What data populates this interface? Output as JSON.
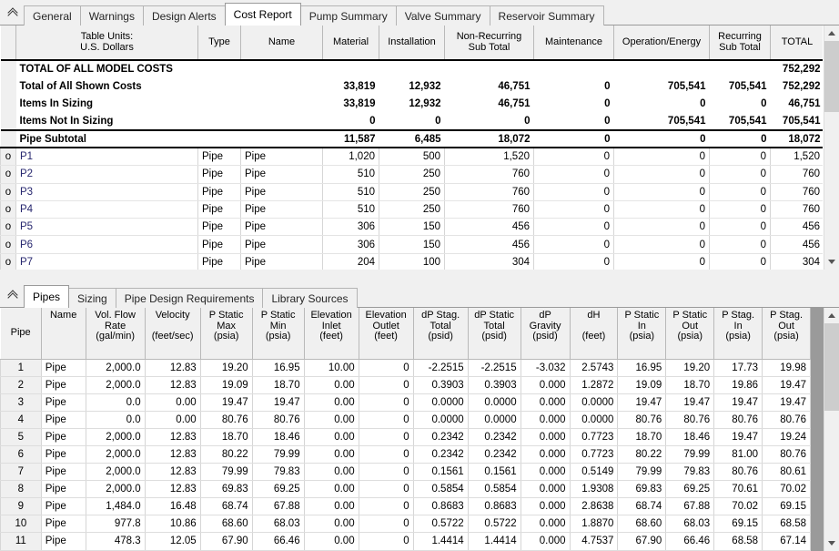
{
  "window": {
    "collapse_icon": "double-chevron-up-icon"
  },
  "top_tabs": {
    "items": [
      {
        "label": "General",
        "active": false
      },
      {
        "label": "Warnings",
        "active": false
      },
      {
        "label": "Design Alerts",
        "active": false
      },
      {
        "label": "Cost Report",
        "active": true
      },
      {
        "label": "Pump Summary",
        "active": false
      },
      {
        "label": "Valve Summary",
        "active": false
      },
      {
        "label": "Reservoir Summary",
        "active": false
      }
    ]
  },
  "cost_report": {
    "columns": [
      {
        "key": "marker",
        "label": ""
      },
      {
        "key": "name",
        "label": "Table Units:\nU.S. Dollars"
      },
      {
        "key": "type",
        "label": "Type"
      },
      {
        "key": "item_name",
        "label": "Name"
      },
      {
        "key": "material",
        "label": "Material"
      },
      {
        "key": "installation",
        "label": "Installation"
      },
      {
        "key": "nonrecurring",
        "label": "Non-Recurring\nSub Total"
      },
      {
        "key": "maintenance",
        "label": "Maintenance"
      },
      {
        "key": "operation",
        "label": "Operation/Energy"
      },
      {
        "key": "recurring",
        "label": "Recurring\nSub Total"
      },
      {
        "key": "total",
        "label": "TOTAL"
      }
    ],
    "column_labels": {
      "units_line1": "Table Units:",
      "units_line2": "U.S. Dollars",
      "type": "Type",
      "name": "Name",
      "material": "Material",
      "installation": "Installation",
      "nonrecurring_line1": "Non-Recurring",
      "nonrecurring_line2": "Sub Total",
      "maintenance": "Maintenance",
      "operation": "Operation/Energy",
      "recurring_line1": "Recurring",
      "recurring_line2": "Sub Total",
      "total": "TOTAL"
    },
    "summary_rows": [
      {
        "label": "TOTAL OF ALL MODEL COSTS",
        "material": "",
        "installation": "",
        "nonrecurring": "",
        "maintenance": "",
        "operation": "",
        "recurring": "",
        "total": "752,292"
      },
      {
        "label": "Total of All Shown Costs",
        "material": "33,819",
        "installation": "12,932",
        "nonrecurring": "46,751",
        "maintenance": "0",
        "operation": "705,541",
        "recurring": "705,541",
        "total": "752,292"
      },
      {
        "label": "Items In Sizing",
        "material": "33,819",
        "installation": "12,932",
        "nonrecurring": "46,751",
        "maintenance": "0",
        "operation": "0",
        "recurring": "0",
        "total": "46,751"
      },
      {
        "label": "Items Not In Sizing",
        "material": "0",
        "installation": "0",
        "nonrecurring": "0",
        "maintenance": "0",
        "operation": "705,541",
        "recurring": "705,541",
        "total": "705,541"
      },
      {
        "label": "Pipe Subtotal",
        "material": "11,587",
        "installation": "6,485",
        "nonrecurring": "18,072",
        "maintenance": "0",
        "operation": "0",
        "recurring": "0",
        "total": "18,072"
      }
    ],
    "item_rows": [
      {
        "marker": "o",
        "label": "P1",
        "type": "Pipe",
        "item_name": "Pipe",
        "material": "1,020",
        "installation": "500",
        "nonrecurring": "1,520",
        "maintenance": "0",
        "operation": "0",
        "recurring": "0",
        "total": "1,520"
      },
      {
        "marker": "o",
        "label": "P2",
        "type": "Pipe",
        "item_name": "Pipe",
        "material": "510",
        "installation": "250",
        "nonrecurring": "760",
        "maintenance": "0",
        "operation": "0",
        "recurring": "0",
        "total": "760"
      },
      {
        "marker": "o",
        "label": "P3",
        "type": "Pipe",
        "item_name": "Pipe",
        "material": "510",
        "installation": "250",
        "nonrecurring": "760",
        "maintenance": "0",
        "operation": "0",
        "recurring": "0",
        "total": "760"
      },
      {
        "marker": "o",
        "label": "P4",
        "type": "Pipe",
        "item_name": "Pipe",
        "material": "510",
        "installation": "250",
        "nonrecurring": "760",
        "maintenance": "0",
        "operation": "0",
        "recurring": "0",
        "total": "760"
      },
      {
        "marker": "o",
        "label": "P5",
        "type": "Pipe",
        "item_name": "Pipe",
        "material": "306",
        "installation": "150",
        "nonrecurring": "456",
        "maintenance": "0",
        "operation": "0",
        "recurring": "0",
        "total": "456"
      },
      {
        "marker": "o",
        "label": "P6",
        "type": "Pipe",
        "item_name": "Pipe",
        "material": "306",
        "installation": "150",
        "nonrecurring": "456",
        "maintenance": "0",
        "operation": "0",
        "recurring": "0",
        "total": "456"
      },
      {
        "marker": "o",
        "label": "P7",
        "type": "Pipe",
        "item_name": "Pipe",
        "material": "204",
        "installation": "100",
        "nonrecurring": "304",
        "maintenance": "0",
        "operation": "0",
        "recurring": "0",
        "total": "304"
      }
    ]
  },
  "bottom_tabs": {
    "items": [
      {
        "label": "Pipes",
        "active": true
      },
      {
        "label": "Sizing",
        "active": false
      },
      {
        "label": "Pipe Design Requirements",
        "active": false
      },
      {
        "label": "Library Sources",
        "active": false
      }
    ]
  },
  "pipes_table": {
    "column_labels": {
      "pipe": "Pipe",
      "name": "Name",
      "volflow_l1": "Vol. Flow",
      "volflow_l2": "Rate",
      "volflow_l3": "(gal/min)",
      "velocity_l1": "Velocity",
      "velocity_l2": "(feet/sec)",
      "pstaticmax_l1": "P Static",
      "pstaticmax_l2": "Max",
      "pstaticmax_l3": "(psia)",
      "pstaticmin_l1": "P Static",
      "pstaticmin_l2": "Min",
      "pstaticmin_l3": "(psia)",
      "elevin_l1": "Elevation",
      "elevin_l2": "Inlet",
      "elevin_l3": "(feet)",
      "elevout_l1": "Elevation",
      "elevout_l2": "Outlet",
      "elevout_l3": "(feet)",
      "dpstag_l1": "dP Stag.",
      "dpstag_l2": "Total",
      "dpstag_l3": "(psid)",
      "dpstatic_l1": "dP Static",
      "dpstatic_l2": "Total",
      "dpstatic_l3": "(psid)",
      "dpgrav_l1": "dP",
      "dpgrav_l2": "Gravity",
      "dpgrav_l3": "(psid)",
      "dh_l1": "dH",
      "dh_l2": "(feet)",
      "pstatin_l1": "P Static",
      "pstatin_l2": "In",
      "pstatin_l3": "(psia)",
      "pstatout_l1": "P Static",
      "pstatout_l2": "Out",
      "pstatout_l3": "(psia)",
      "pstagin_l1": "P Stag.",
      "pstagin_l2": "In",
      "pstagin_l3": "(psia)",
      "pstagout_l1": "P Stag.",
      "pstagout_l2": "Out",
      "pstagout_l3": "(psia)"
    },
    "rows": [
      {
        "num": "1",
        "name": "Pipe",
        "volflow": "2,000.0",
        "velocity": "12.83",
        "pstatic_max": "19.20",
        "pstatic_min": "16.95",
        "elev_in": "10.00",
        "elev_out": "0",
        "dp_stag_total": "-2.2515",
        "dp_static_total": "-2.2515",
        "dp_gravity": "-3.032",
        "dh": "2.5743",
        "pstat_in": "16.95",
        "pstat_out": "19.20",
        "pstag_in": "17.73",
        "pstag_out": "19.98"
      },
      {
        "num": "2",
        "name": "Pipe",
        "volflow": "2,000.0",
        "velocity": "12.83",
        "pstatic_max": "19.09",
        "pstatic_min": "18.70",
        "elev_in": "0.00",
        "elev_out": "0",
        "dp_stag_total": "0.3903",
        "dp_static_total": "0.3903",
        "dp_gravity": "0.000",
        "dh": "1.2872",
        "pstat_in": "19.09",
        "pstat_out": "18.70",
        "pstag_in": "19.86",
        "pstag_out": "19.47"
      },
      {
        "num": "3",
        "name": "Pipe",
        "volflow": "0.0",
        "velocity": "0.00",
        "pstatic_max": "19.47",
        "pstatic_min": "19.47",
        "elev_in": "0.00",
        "elev_out": "0",
        "dp_stag_total": "0.0000",
        "dp_static_total": "0.0000",
        "dp_gravity": "0.000",
        "dh": "0.0000",
        "pstat_in": "19.47",
        "pstat_out": "19.47",
        "pstag_in": "19.47",
        "pstag_out": "19.47"
      },
      {
        "num": "4",
        "name": "Pipe",
        "volflow": "0.0",
        "velocity": "0.00",
        "pstatic_max": "80.76",
        "pstatic_min": "80.76",
        "elev_in": "0.00",
        "elev_out": "0",
        "dp_stag_total": "0.0000",
        "dp_static_total": "0.0000",
        "dp_gravity": "0.000",
        "dh": "0.0000",
        "pstat_in": "80.76",
        "pstat_out": "80.76",
        "pstag_in": "80.76",
        "pstag_out": "80.76"
      },
      {
        "num": "5",
        "name": "Pipe",
        "volflow": "2,000.0",
        "velocity": "12.83",
        "pstatic_max": "18.70",
        "pstatic_min": "18.46",
        "elev_in": "0.00",
        "elev_out": "0",
        "dp_stag_total": "0.2342",
        "dp_static_total": "0.2342",
        "dp_gravity": "0.000",
        "dh": "0.7723",
        "pstat_in": "18.70",
        "pstat_out": "18.46",
        "pstag_in": "19.47",
        "pstag_out": "19.24"
      },
      {
        "num": "6",
        "name": "Pipe",
        "volflow": "2,000.0",
        "velocity": "12.83",
        "pstatic_max": "80.22",
        "pstatic_min": "79.99",
        "elev_in": "0.00",
        "elev_out": "0",
        "dp_stag_total": "0.2342",
        "dp_static_total": "0.2342",
        "dp_gravity": "0.000",
        "dh": "0.7723",
        "pstat_in": "80.22",
        "pstat_out": "79.99",
        "pstag_in": "81.00",
        "pstag_out": "80.76"
      },
      {
        "num": "7",
        "name": "Pipe",
        "volflow": "2,000.0",
        "velocity": "12.83",
        "pstatic_max": "79.99",
        "pstatic_min": "79.83",
        "elev_in": "0.00",
        "elev_out": "0",
        "dp_stag_total": "0.1561",
        "dp_static_total": "0.1561",
        "dp_gravity": "0.000",
        "dh": "0.5149",
        "pstat_in": "79.99",
        "pstat_out": "79.83",
        "pstag_in": "80.76",
        "pstag_out": "80.61"
      },
      {
        "num": "8",
        "name": "Pipe",
        "volflow": "2,000.0",
        "velocity": "12.83",
        "pstatic_max": "69.83",
        "pstatic_min": "69.25",
        "elev_in": "0.00",
        "elev_out": "0",
        "dp_stag_total": "0.5854",
        "dp_static_total": "0.5854",
        "dp_gravity": "0.000",
        "dh": "1.9308",
        "pstat_in": "69.83",
        "pstat_out": "69.25",
        "pstag_in": "70.61",
        "pstag_out": "70.02"
      },
      {
        "num": "9",
        "name": "Pipe",
        "volflow": "1,484.0",
        "velocity": "16.48",
        "pstatic_max": "68.74",
        "pstatic_min": "67.88",
        "elev_in": "0.00",
        "elev_out": "0",
        "dp_stag_total": "0.8683",
        "dp_static_total": "0.8683",
        "dp_gravity": "0.000",
        "dh": "2.8638",
        "pstat_in": "68.74",
        "pstat_out": "67.88",
        "pstag_in": "70.02",
        "pstag_out": "69.15"
      },
      {
        "num": "10",
        "name": "Pipe",
        "volflow": "977.8",
        "velocity": "10.86",
        "pstatic_max": "68.60",
        "pstatic_min": "68.03",
        "elev_in": "0.00",
        "elev_out": "0",
        "dp_stag_total": "0.5722",
        "dp_static_total": "0.5722",
        "dp_gravity": "0.000",
        "dh": "1.8870",
        "pstat_in": "68.60",
        "pstat_out": "68.03",
        "pstag_in": "69.15",
        "pstag_out": "68.58"
      },
      {
        "num": "11",
        "name": "Pipe",
        "volflow": "478.3",
        "velocity": "12.05",
        "pstatic_max": "67.90",
        "pstatic_min": "66.46",
        "elev_in": "0.00",
        "elev_out": "0",
        "dp_stag_total": "1.4414",
        "dp_static_total": "1.4414",
        "dp_gravity": "0.000",
        "dh": "4.7537",
        "pstat_in": "67.90",
        "pstat_out": "66.46",
        "pstag_in": "68.58",
        "pstag_out": "67.14"
      }
    ]
  },
  "scrollbars": {
    "up_arrow": "chevron-up-icon",
    "down_arrow": "chevron-down-icon"
  }
}
